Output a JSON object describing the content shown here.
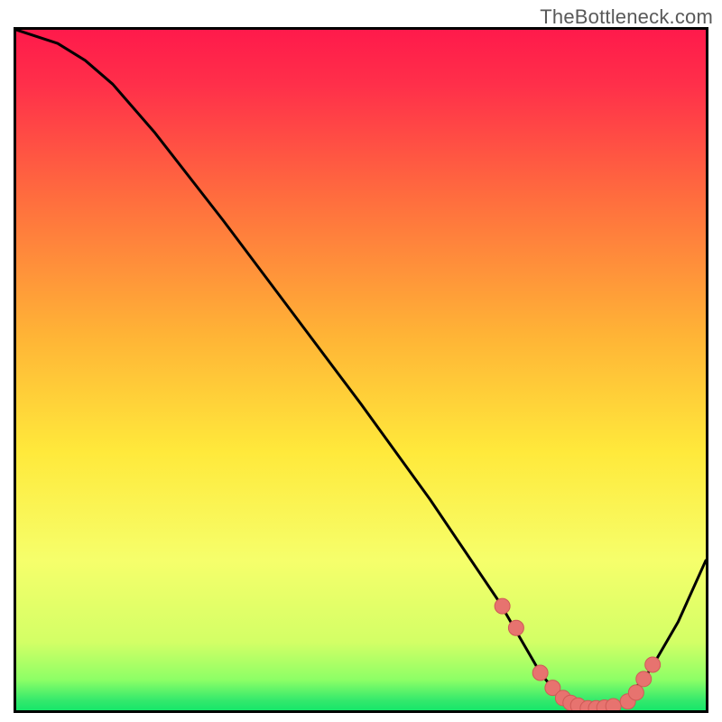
{
  "watermark": "TheBottleneck.com",
  "colors": {
    "gradient_top": "#ff1a4b",
    "gradient_mid1": "#ff8a2b",
    "gradient_mid2": "#ffe93b",
    "gradient_mid3": "#f6ff6b",
    "gradient_bottom": "#17e66a",
    "curve": "#000000",
    "marker_fill": "#e7736f",
    "marker_stroke": "#cf5a56"
  },
  "chart_data": {
    "type": "line",
    "title": "",
    "xlabel": "",
    "ylabel": "",
    "xlim": [
      0,
      100
    ],
    "ylim": [
      0,
      100
    ],
    "series": [
      {
        "name": "bottleneck-curve",
        "x": [
          0,
          6,
          10,
          14,
          20,
          30,
          40,
          50,
          60,
          66,
          70,
          74,
          76,
          78,
          80,
          82,
          84,
          86,
          88,
          92,
          96,
          100
        ],
        "y": [
          100,
          98,
          95.5,
          92,
          85,
          72,
          58.5,
          45,
          31,
          22,
          16,
          9,
          5.5,
          3,
          1.5,
          0.7,
          0.3,
          0.4,
          1,
          6,
          13,
          22
        ]
      }
    ],
    "markers": {
      "name": "highlight-dots",
      "x": [
        70.5,
        72.5,
        76,
        77.8,
        79.3,
        80.4,
        81.5,
        82.9,
        84.1,
        85.3,
        86.6,
        88.7,
        89.9,
        91.0,
        92.3
      ],
      "y": [
        15.3,
        12.1,
        5.5,
        3.3,
        1.8,
        1.1,
        0.7,
        0.3,
        0.3,
        0.4,
        0.6,
        1.3,
        2.6,
        4.6,
        6.7
      ]
    },
    "gradient_stops": [
      {
        "offset": 0.0,
        "color": "#ff1a4b"
      },
      {
        "offset": 0.08,
        "color": "#ff2f4a"
      },
      {
        "offset": 0.25,
        "color": "#ff6e3e"
      },
      {
        "offset": 0.45,
        "color": "#ffb436"
      },
      {
        "offset": 0.62,
        "color": "#ffe93b"
      },
      {
        "offset": 0.78,
        "color": "#f6ff6b"
      },
      {
        "offset": 0.9,
        "color": "#d3ff66"
      },
      {
        "offset": 0.955,
        "color": "#8dff66"
      },
      {
        "offset": 0.985,
        "color": "#35e96c"
      },
      {
        "offset": 1.0,
        "color": "#17e66a"
      }
    ]
  }
}
